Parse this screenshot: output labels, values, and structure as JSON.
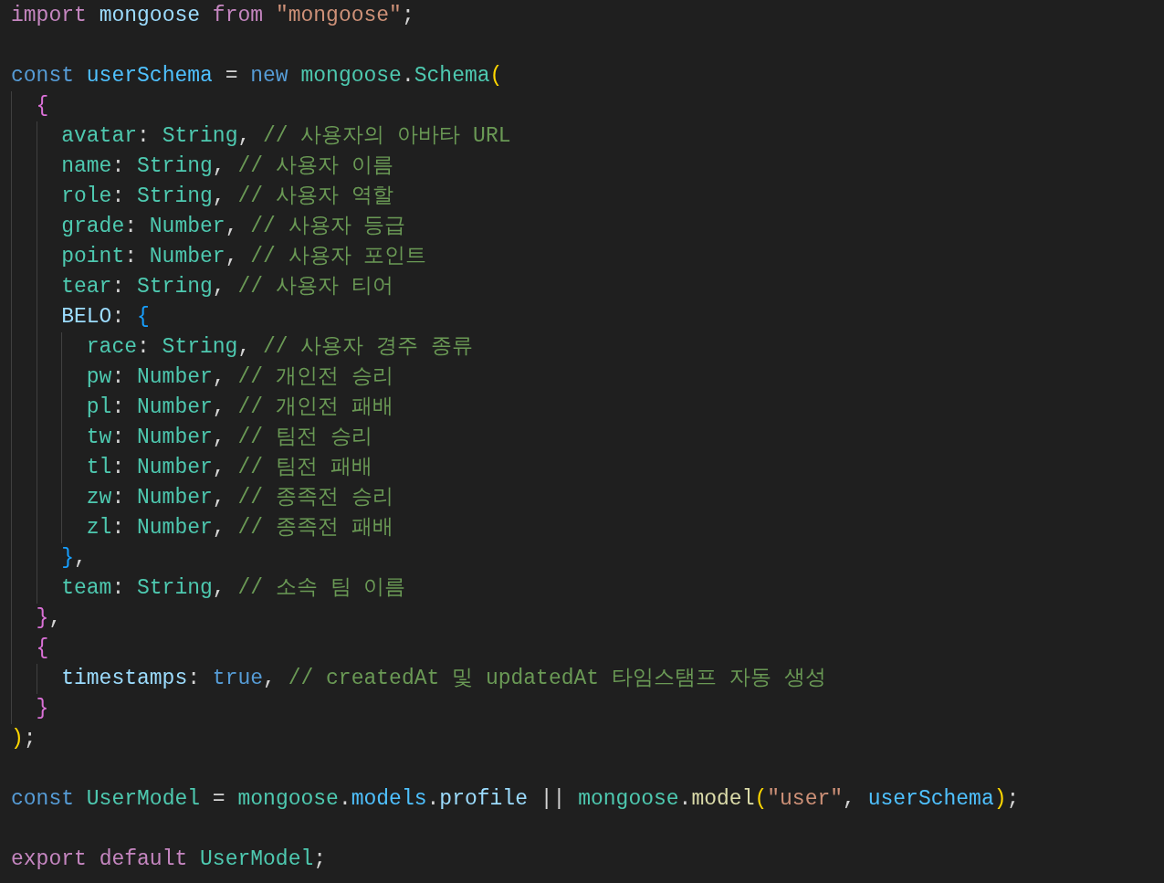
{
  "editor": {
    "lines": [
      {
        "tokens": [
          {
            "kind": "control",
            "text": "import"
          },
          {
            "kind": "variable",
            "text": " mongoose"
          },
          {
            "kind": "control",
            "text": " from"
          },
          {
            "kind": "string",
            "text": " \"mongoose\""
          },
          {
            "kind": "punct",
            "text": ";"
          }
        ]
      },
      {
        "kind": "blank"
      },
      {
        "kind": "code",
        "tokens": [
          {
            "kind": "keyword",
            "text": "const"
          },
          {
            "kind": "constant",
            "text": " userSchema"
          },
          {
            "kind": "punct",
            "text": " = "
          },
          {
            "kind": "keyword",
            "text": "new"
          },
          {
            "kind": "type",
            "text": " mongoose"
          },
          {
            "kind": "punct",
            "text": "."
          },
          {
            "kind": "type",
            "text": "Schema"
          },
          {
            "kind": "bracket1",
            "text": "("
          }
        ],
        "children": [
          {
            "tokens": [
              {
                "kind": "bracket2",
                "text": "{"
              }
            ],
            "children": [
              {
                "tokens": [
                  {
                    "kind": "type",
                    "text": "avatar"
                  },
                  {
                    "kind": "punct",
                    "text": ": "
                  },
                  {
                    "kind": "type",
                    "text": "String"
                  },
                  {
                    "kind": "punct",
                    "text": ", "
                  },
                  {
                    "kind": "comment",
                    "text": "// 사용자의 아바타 URL"
                  }
                ]
              },
              {
                "tokens": [
                  {
                    "kind": "type",
                    "text": "name"
                  },
                  {
                    "kind": "punct",
                    "text": ": "
                  },
                  {
                    "kind": "type",
                    "text": "String"
                  },
                  {
                    "kind": "punct",
                    "text": ", "
                  },
                  {
                    "kind": "comment",
                    "text": "// 사용자 이름"
                  }
                ]
              },
              {
                "tokens": [
                  {
                    "kind": "type",
                    "text": "role"
                  },
                  {
                    "kind": "punct",
                    "text": ": "
                  },
                  {
                    "kind": "type",
                    "text": "String"
                  },
                  {
                    "kind": "punct",
                    "text": ", "
                  },
                  {
                    "kind": "comment",
                    "text": "// 사용자 역할"
                  }
                ]
              },
              {
                "tokens": [
                  {
                    "kind": "type",
                    "text": "grade"
                  },
                  {
                    "kind": "punct",
                    "text": ": "
                  },
                  {
                    "kind": "type",
                    "text": "Number"
                  },
                  {
                    "kind": "punct",
                    "text": ", "
                  },
                  {
                    "kind": "comment",
                    "text": "// 사용자 등급"
                  }
                ]
              },
              {
                "tokens": [
                  {
                    "kind": "type",
                    "text": "point"
                  },
                  {
                    "kind": "punct",
                    "text": ": "
                  },
                  {
                    "kind": "type",
                    "text": "Number"
                  },
                  {
                    "kind": "punct",
                    "text": ", "
                  },
                  {
                    "kind": "comment",
                    "text": "// 사용자 포인트"
                  }
                ]
              },
              {
                "tokens": [
                  {
                    "kind": "type",
                    "text": "tear"
                  },
                  {
                    "kind": "punct",
                    "text": ": "
                  },
                  {
                    "kind": "type",
                    "text": "String"
                  },
                  {
                    "kind": "punct",
                    "text": ", "
                  },
                  {
                    "kind": "comment",
                    "text": "// 사용자 티어"
                  }
                ]
              },
              {
                "tokens": [
                  {
                    "kind": "variable",
                    "text": "BELO"
                  },
                  {
                    "kind": "punct",
                    "text": ": "
                  },
                  {
                    "kind": "bracket3",
                    "text": "{"
                  }
                ],
                "children": [
                  {
                    "tokens": [
                      {
                        "kind": "type",
                        "text": "race"
                      },
                      {
                        "kind": "punct",
                        "text": ": "
                      },
                      {
                        "kind": "type",
                        "text": "String"
                      },
                      {
                        "kind": "punct",
                        "text": ", "
                      },
                      {
                        "kind": "comment",
                        "text": "// 사용자 경주 종류"
                      }
                    ]
                  },
                  {
                    "tokens": [
                      {
                        "kind": "type",
                        "text": "pw"
                      },
                      {
                        "kind": "punct",
                        "text": ": "
                      },
                      {
                        "kind": "type",
                        "text": "Number"
                      },
                      {
                        "kind": "punct",
                        "text": ", "
                      },
                      {
                        "kind": "comment",
                        "text": "// 개인전 승리"
                      }
                    ]
                  },
                  {
                    "tokens": [
                      {
                        "kind": "type",
                        "text": "pl"
                      },
                      {
                        "kind": "punct",
                        "text": ": "
                      },
                      {
                        "kind": "type",
                        "text": "Number"
                      },
                      {
                        "kind": "punct",
                        "text": ", "
                      },
                      {
                        "kind": "comment",
                        "text": "// 개인전 패배"
                      }
                    ]
                  },
                  {
                    "tokens": [
                      {
                        "kind": "type",
                        "text": "tw"
                      },
                      {
                        "kind": "punct",
                        "text": ": "
                      },
                      {
                        "kind": "type",
                        "text": "Number"
                      },
                      {
                        "kind": "punct",
                        "text": ", "
                      },
                      {
                        "kind": "comment",
                        "text": "// 팀전 승리"
                      }
                    ]
                  },
                  {
                    "tokens": [
                      {
                        "kind": "type",
                        "text": "tl"
                      },
                      {
                        "kind": "punct",
                        "text": ": "
                      },
                      {
                        "kind": "type",
                        "text": "Number"
                      },
                      {
                        "kind": "punct",
                        "text": ", "
                      },
                      {
                        "kind": "comment",
                        "text": "// 팀전 패배"
                      }
                    ]
                  },
                  {
                    "tokens": [
                      {
                        "kind": "type",
                        "text": "zw"
                      },
                      {
                        "kind": "punct",
                        "text": ": "
                      },
                      {
                        "kind": "type",
                        "text": "Number"
                      },
                      {
                        "kind": "punct",
                        "text": ", "
                      },
                      {
                        "kind": "comment",
                        "text": "// 종족전 승리"
                      }
                    ]
                  },
                  {
                    "tokens": [
                      {
                        "kind": "type",
                        "text": "zl"
                      },
                      {
                        "kind": "punct",
                        "text": ": "
                      },
                      {
                        "kind": "type",
                        "text": "Number"
                      },
                      {
                        "kind": "punct",
                        "text": ", "
                      },
                      {
                        "kind": "comment",
                        "text": "// 종족전 패배"
                      }
                    ]
                  }
                ]
              },
              {
                "tokens": [
                  {
                    "kind": "bracket3",
                    "text": "}"
                  },
                  {
                    "kind": "punct",
                    "text": ","
                  }
                ]
              },
              {
                "tokens": [
                  {
                    "kind": "type",
                    "text": "team"
                  },
                  {
                    "kind": "punct",
                    "text": ": "
                  },
                  {
                    "kind": "type",
                    "text": "String"
                  },
                  {
                    "kind": "punct",
                    "text": ", "
                  },
                  {
                    "kind": "comment",
                    "text": "// 소속 팀 이름"
                  }
                ]
              }
            ]
          },
          {
            "tokens": [
              {
                "kind": "bracket2",
                "text": "}"
              },
              {
                "kind": "punct",
                "text": ","
              }
            ]
          },
          {
            "tokens": [
              {
                "kind": "bracket2",
                "text": "{"
              }
            ],
            "children": [
              {
                "tokens": [
                  {
                    "kind": "variable",
                    "text": "timestamps"
                  },
                  {
                    "kind": "punct",
                    "text": ": "
                  },
                  {
                    "kind": "keyword",
                    "text": "true"
                  },
                  {
                    "kind": "punct",
                    "text": ", "
                  },
                  {
                    "kind": "comment",
                    "text": "// createdAt 및 updatedAt 타임스탬프 자동 생성"
                  }
                ]
              }
            ]
          },
          {
            "tokens": [
              {
                "kind": "bracket2",
                "text": "}"
              }
            ]
          }
        ]
      },
      {
        "tokens": [
          {
            "kind": "bracket1",
            "text": ")"
          },
          {
            "kind": "punct",
            "text": ";"
          }
        ]
      },
      {
        "kind": "blank"
      },
      {
        "kind": "code",
        "tokens": [
          {
            "kind": "keyword",
            "text": "const"
          },
          {
            "kind": "type",
            "text": " UserModel"
          },
          {
            "kind": "punct",
            "text": " = "
          },
          {
            "kind": "type",
            "text": "mongoose"
          },
          {
            "kind": "punct",
            "text": "."
          },
          {
            "kind": "constant",
            "text": "models"
          },
          {
            "kind": "punct",
            "text": "."
          },
          {
            "kind": "variable",
            "text": "profile"
          },
          {
            "kind": "punct",
            "text": " || "
          },
          {
            "kind": "type",
            "text": "mongoose"
          },
          {
            "kind": "punct",
            "text": "."
          },
          {
            "kind": "function",
            "text": "model"
          },
          {
            "kind": "bracket1",
            "text": "("
          },
          {
            "kind": "string",
            "text": "\"user\""
          },
          {
            "kind": "punct",
            "text": ", "
          },
          {
            "kind": "constant",
            "text": "userSchema"
          },
          {
            "kind": "bracket1",
            "text": ")"
          },
          {
            "kind": "punct",
            "text": ";"
          }
        ]
      },
      {
        "kind": "blank"
      },
      {
        "kind": "code",
        "tokens": [
          {
            "kind": "control",
            "text": "export"
          },
          {
            "kind": "control",
            "text": " default"
          },
          {
            "kind": "type",
            "text": " UserModel"
          },
          {
            "kind": "punct",
            "text": ";"
          }
        ]
      }
    ]
  }
}
